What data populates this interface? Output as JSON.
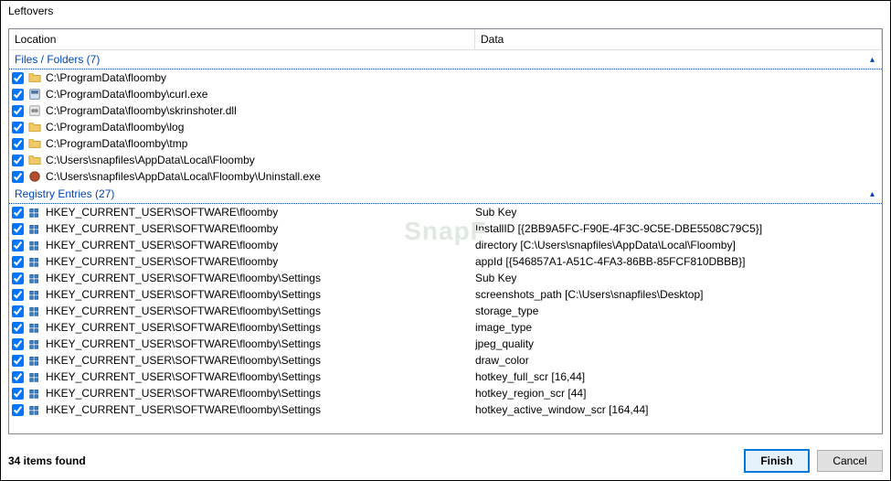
{
  "window": {
    "title": "Leftovers"
  },
  "columns": {
    "location": "Location",
    "data": "Data"
  },
  "sections": {
    "files": {
      "label": "Files / Folders",
      "count": 7
    },
    "registry": {
      "label": "Registry Entries",
      "count": 27
    }
  },
  "file_rows": [
    {
      "icon": "folder",
      "location": "C:\\ProgramData\\floomby",
      "data": ""
    },
    {
      "icon": "exe",
      "location": "C:\\ProgramData\\floomby\\curl.exe",
      "data": ""
    },
    {
      "icon": "dll",
      "location": "C:\\ProgramData\\floomby\\skrinshoter.dll",
      "data": ""
    },
    {
      "icon": "folder",
      "location": "C:\\ProgramData\\floomby\\log",
      "data": ""
    },
    {
      "icon": "folder",
      "location": "C:\\ProgramData\\floomby\\tmp",
      "data": ""
    },
    {
      "icon": "folder",
      "location": "C:\\Users\\snapfiles\\AppData\\Local\\Floomby",
      "data": ""
    },
    {
      "icon": "uninst",
      "location": "C:\\Users\\snapfiles\\AppData\\Local\\Floomby\\Uninstall.exe",
      "data": ""
    }
  ],
  "registry_rows": [
    {
      "icon": "reg",
      "location": "HKEY_CURRENT_USER\\SOFTWARE\\floomby",
      "data": "Sub Key"
    },
    {
      "icon": "reg",
      "location": "HKEY_CURRENT_USER\\SOFTWARE\\floomby",
      "data": "InstallID [{2BB9A5FC-F90E-4F3C-9C5E-DBE5508C79C5}]"
    },
    {
      "icon": "reg",
      "location": "HKEY_CURRENT_USER\\SOFTWARE\\floomby",
      "data": "directory [C:\\Users\\snapfiles\\AppData\\Local\\Floomby]"
    },
    {
      "icon": "reg",
      "location": "HKEY_CURRENT_USER\\SOFTWARE\\floomby",
      "data": "appId [{546857A1-A51C-4FA3-86BB-85FCF810DBBB}]"
    },
    {
      "icon": "reg",
      "location": "HKEY_CURRENT_USER\\SOFTWARE\\floomby\\Settings",
      "data": "Sub Key"
    },
    {
      "icon": "reg",
      "location": "HKEY_CURRENT_USER\\SOFTWARE\\floomby\\Settings",
      "data": "screenshots_path [C:\\Users\\snapfiles\\Desktop]"
    },
    {
      "icon": "reg",
      "location": "HKEY_CURRENT_USER\\SOFTWARE\\floomby\\Settings",
      "data": "storage_type"
    },
    {
      "icon": "reg",
      "location": "HKEY_CURRENT_USER\\SOFTWARE\\floomby\\Settings",
      "data": "image_type"
    },
    {
      "icon": "reg",
      "location": "HKEY_CURRENT_USER\\SOFTWARE\\floomby\\Settings",
      "data": "jpeg_quality"
    },
    {
      "icon": "reg",
      "location": "HKEY_CURRENT_USER\\SOFTWARE\\floomby\\Settings",
      "data": "draw_color"
    },
    {
      "icon": "reg",
      "location": "HKEY_CURRENT_USER\\SOFTWARE\\floomby\\Settings",
      "data": "hotkey_full_scr [16,44]"
    },
    {
      "icon": "reg",
      "location": "HKEY_CURRENT_USER\\SOFTWARE\\floomby\\Settings",
      "data": "hotkey_region_scr [44]"
    },
    {
      "icon": "reg",
      "location": "HKEY_CURRENT_USER\\SOFTWARE\\floomby\\Settings",
      "data": "hotkey_active_window_scr [164,44]"
    }
  ],
  "footer": {
    "status": "34 items found",
    "finish": "Finish",
    "cancel": "Cancel"
  },
  "watermark": "SnapF"
}
